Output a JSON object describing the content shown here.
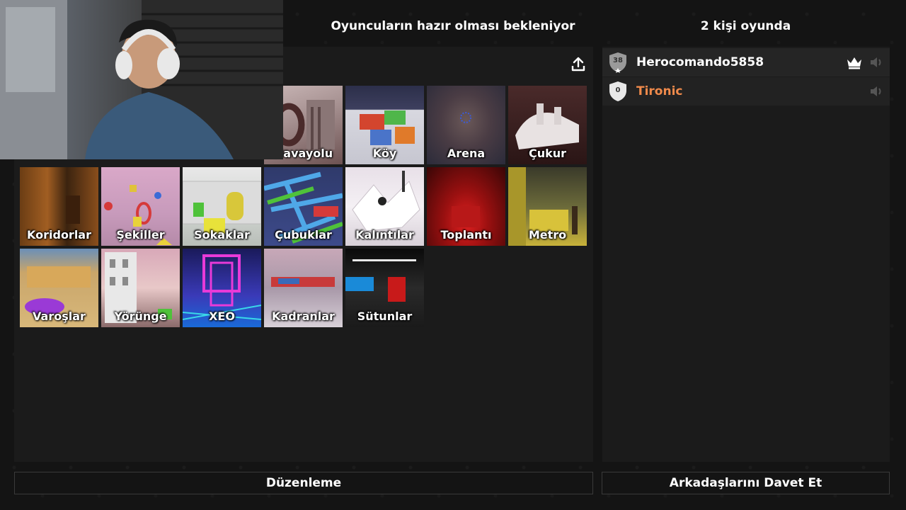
{
  "header": {
    "status_text": "Oyuncuların hazır olması bekleniyor",
    "player_count_text": "2 kişi oyunda"
  },
  "maps": [
    {
      "label": "Hava Yolu",
      "display": "Havayolu"
    },
    {
      "label": "Köy",
      "display": "Köy"
    },
    {
      "label": "Arena",
      "display": "Arena"
    },
    {
      "label": "Çukur",
      "display": "Çukur"
    },
    {
      "label": "Koridorlar",
      "display": "Koridorlar"
    },
    {
      "label": "Şekiller",
      "display": "Şekiller"
    },
    {
      "label": "Sokaklar",
      "display": "Sokaklar"
    },
    {
      "label": "Çubuklar",
      "display": "Çubuklar"
    },
    {
      "label": "Kalıntılar",
      "display": "Kalıntılar"
    },
    {
      "label": "Toplantı",
      "display": "Toplantı"
    },
    {
      "label": "Metro",
      "display": "Metro"
    },
    {
      "label": "Varoşlar",
      "display": "Varoşlar"
    },
    {
      "label": "Yörünge",
      "display": "Yörünge"
    },
    {
      "label": "XEO",
      "display": "XEO"
    },
    {
      "label": "Kadranlar",
      "display": "Kadranlar"
    },
    {
      "label": "Sütunlar",
      "display": "Sütunlar"
    }
  ],
  "players": [
    {
      "name": "Herocomando5858",
      "level": "38",
      "host": true,
      "name_color": "#ffffff"
    },
    {
      "name": "Tironic",
      "level": "0",
      "host": false,
      "name_color": "#f08a4b"
    }
  ],
  "buttons": {
    "edit_label": "Düzenleme",
    "invite_label": "Arkadaşlarını Davet Et"
  },
  "icons": {
    "upload": "upload-icon",
    "crown": "crown-icon",
    "speaker": "speaker-icon",
    "badge": "shield-badge-icon"
  }
}
